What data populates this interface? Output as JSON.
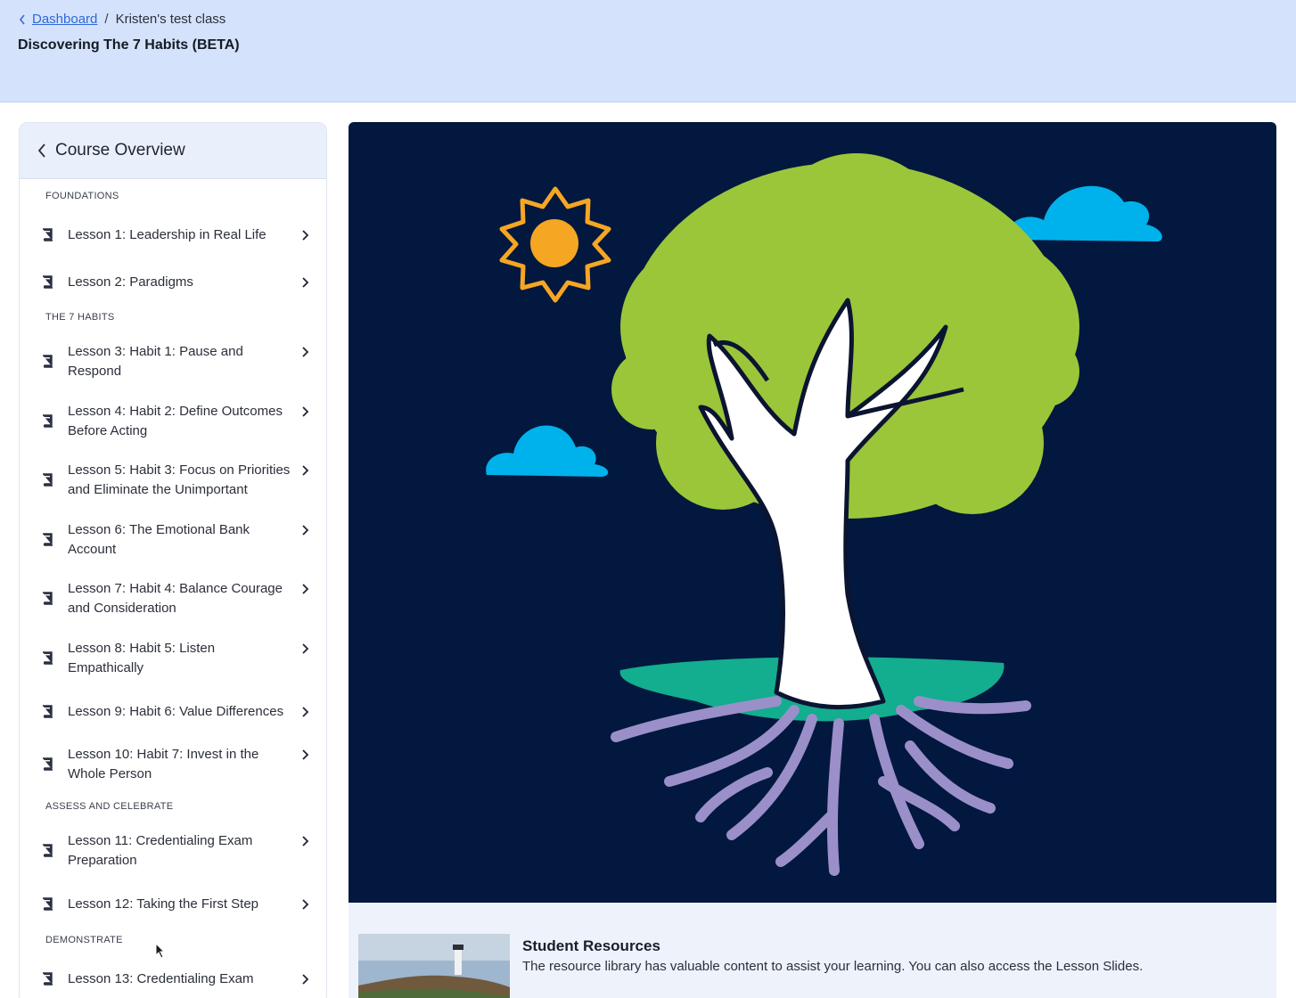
{
  "breadcrumb": {
    "back_icon": "chevron-left-icon",
    "dashboard_label": "Dashboard",
    "separator": "/",
    "current": "Kristen's test class"
  },
  "course": {
    "title": "Discovering The 7 Habits (BETA)"
  },
  "sidebar": {
    "header": "Course Overview",
    "sections": [
      {
        "title": "FOUNDATIONS"
      },
      {
        "title": "THE 7 HABITS"
      },
      {
        "title": "ASSESS AND CELEBRATE"
      },
      {
        "title": "DEMONSTRATE"
      }
    ],
    "lessons": [
      {
        "label": "Lesson 1: Leadership in Real Life"
      },
      {
        "label": "Lesson 2: Paradigms"
      },
      {
        "label": "Lesson 3: Habit 1: Pause and Respond"
      },
      {
        "label": "Lesson 4: Habit 2: Define Outcomes Before Acting"
      },
      {
        "label": "Lesson 5: Habit 3: Focus on Priorities and Eliminate the Unimportant"
      },
      {
        "label": "Lesson 6: The Emotional Bank Account"
      },
      {
        "label": "Lesson 7: Habit 4: Balance Courage and Consideration"
      },
      {
        "label": "Lesson 8: Habit 5: Listen Empathically"
      },
      {
        "label": "Lesson 9: Habit 6: Value Differences"
      },
      {
        "label": "Lesson 10: Habit 7: Invest in the Whole Person"
      },
      {
        "label": "Lesson 11: Credentialing Exam Preparation"
      },
      {
        "label": "Lesson 12: Taking the First Step"
      },
      {
        "label": "Lesson 13: Credentialing Exam"
      }
    ]
  },
  "resources": {
    "title": "Student Resources",
    "description": "The resource library has valuable content to assist your learning. You can also access the Lesson Slides."
  },
  "colors": {
    "header_bg": "#d4e2fb",
    "hero_bg": "#02183e",
    "link": "#2f6ad9",
    "tree_canopy": "#9bc63a",
    "sun": "#f5a623",
    "cloud": "#00b2ec",
    "grass": "#13ad8f",
    "roots": "#9b8fc9"
  }
}
